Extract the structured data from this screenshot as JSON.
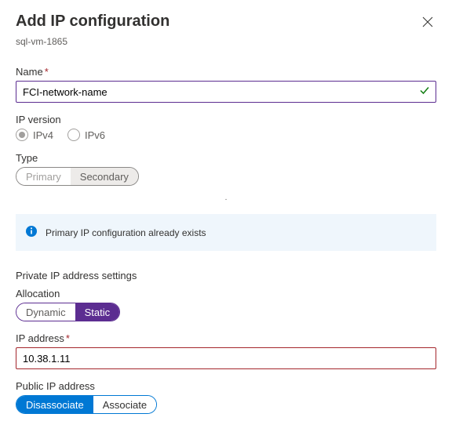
{
  "header": {
    "title": "Add IP configuration",
    "subtitle": "sql-vm-1865"
  },
  "name_field": {
    "label": "Name",
    "value": "FCI-network-name",
    "required_mark": "*"
  },
  "ip_version": {
    "label": "IP version",
    "options": [
      "IPv4",
      "IPv6"
    ],
    "selected": "IPv4"
  },
  "type_field": {
    "label": "Type",
    "options": [
      "Primary",
      "Secondary"
    ],
    "selected": "Secondary"
  },
  "info_message": "Primary IP configuration already exists",
  "private_section": {
    "title": "Private IP address settings",
    "allocation": {
      "label": "Allocation",
      "options": [
        "Dynamic",
        "Static"
      ],
      "selected": "Static"
    },
    "ip_address": {
      "label": "IP address",
      "required_mark": "*",
      "value": "10.38.1.11"
    }
  },
  "public_section": {
    "label": "Public IP address",
    "options": [
      "Disassociate",
      "Associate"
    ],
    "selected": "Disassociate"
  }
}
